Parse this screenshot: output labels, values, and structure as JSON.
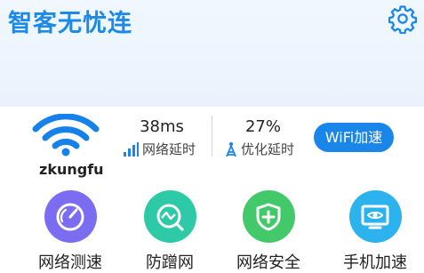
{
  "app_title": "智客无忧连",
  "network": {
    "ssid": "zkungfu"
  },
  "metrics": {
    "latency_value": "38ms",
    "latency_label": "网络延时",
    "optimize_value": "27%",
    "optimize_label": "优化延时"
  },
  "wifi_button_label": "WiFi加速",
  "tools": [
    {
      "label": "网络测速",
      "icon": "speedometer-icon",
      "color": "#7b6cf2"
    },
    {
      "label": "防蹭网",
      "icon": "network-monitor-icon",
      "color": "#2ec9a6"
    },
    {
      "label": "网络安全",
      "icon": "shield-plus-icon",
      "color": "#44c96a"
    },
    {
      "label": "手机加速",
      "icon": "monitor-eye-icon",
      "color": "#2cb3ee"
    }
  ],
  "colors": {
    "accent": "#1a86ea",
    "title": "#1c8ae6"
  }
}
